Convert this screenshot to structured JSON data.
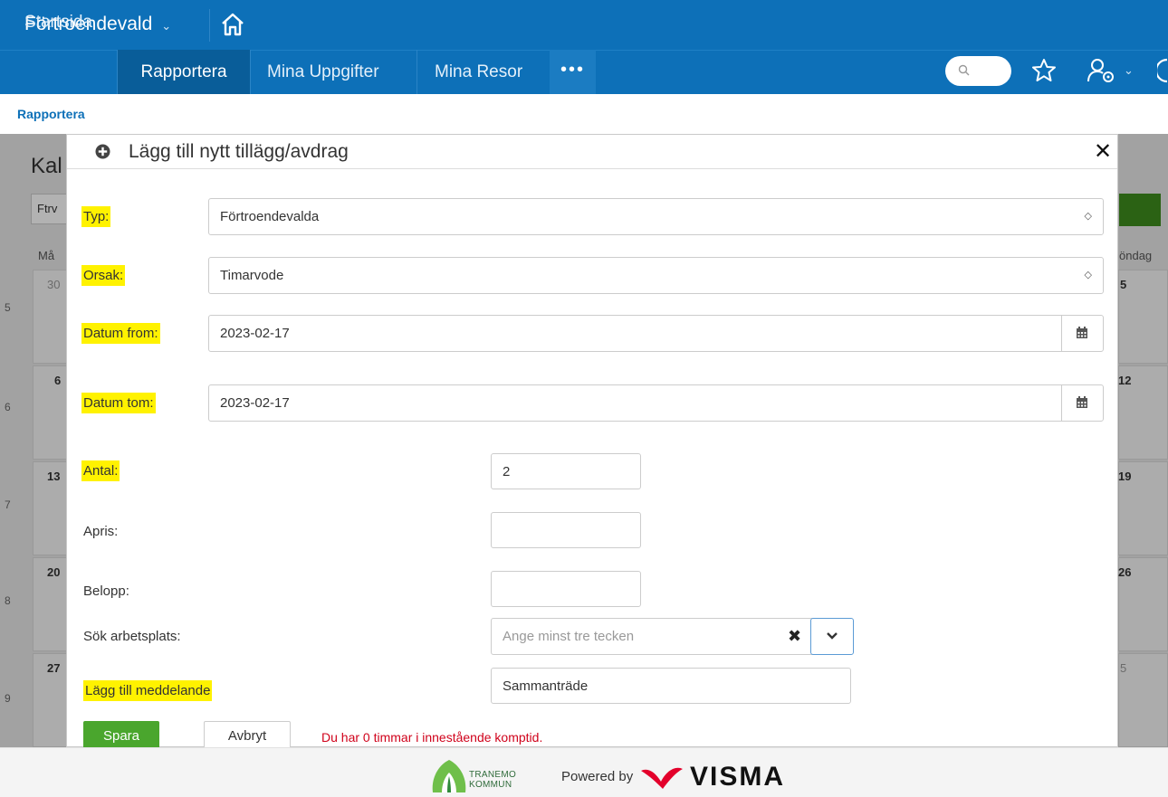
{
  "header": {
    "app_title": "Förtroendevald",
    "app_chevron": "⌄"
  },
  "nav": {
    "items": [
      "Startsida",
      "Rapportera",
      "Mina Uppgifter",
      "Mina Resor"
    ],
    "more_label": "•••"
  },
  "breadcrumb": "Rapportera",
  "background": {
    "heading": "Kal",
    "select_value": "Ftrv",
    "day_left": "Må",
    "day_right": "öndag",
    "weeks": [
      "5",
      "6",
      "7",
      "8",
      "9"
    ],
    "dates_left": [
      "30",
      "6",
      "13",
      "20",
      "27"
    ],
    "dates_right": [
      "5",
      "12",
      "19",
      "26",
      "5"
    ]
  },
  "modal": {
    "title": "Lägg till nytt tillägg/avdrag",
    "close_label": "✕",
    "fields": {
      "typ": {
        "label": "Typ:",
        "value": "Förtroendevalda"
      },
      "orsak": {
        "label": "Orsak:",
        "value": "Timarvode"
      },
      "datum_from": {
        "label": "Datum from:",
        "value": "2023-02-17"
      },
      "datum_tom": {
        "label": "Datum tom:",
        "value": "2023-02-17"
      },
      "antal": {
        "label": "Antal:",
        "value": "2"
      },
      "apris": {
        "label": "Apris:",
        "value": ""
      },
      "belopp": {
        "label": "Belopp:",
        "value": ""
      },
      "arbetsplats": {
        "label": "Sök arbetsplats:",
        "placeholder": "Ange minst tre tecken"
      },
      "meddelande": {
        "label": "Lägg till meddelande",
        "value": "Sammanträde"
      }
    },
    "buttons": {
      "save": "Spara",
      "cancel": "Avbryt"
    },
    "warning": "Du har 0 timmar i innestående komptid."
  },
  "footer": {
    "tranemo_line1": "TRANEMO",
    "tranemo_line2": "KOMMUN",
    "powered_by": "Powered by",
    "visma": "VISMA"
  },
  "colors": {
    "brand_blue": "#0d70b8",
    "save_green": "#4aa62d",
    "warning_red": "#d0021b",
    "highlight_yellow": "#fff200"
  }
}
